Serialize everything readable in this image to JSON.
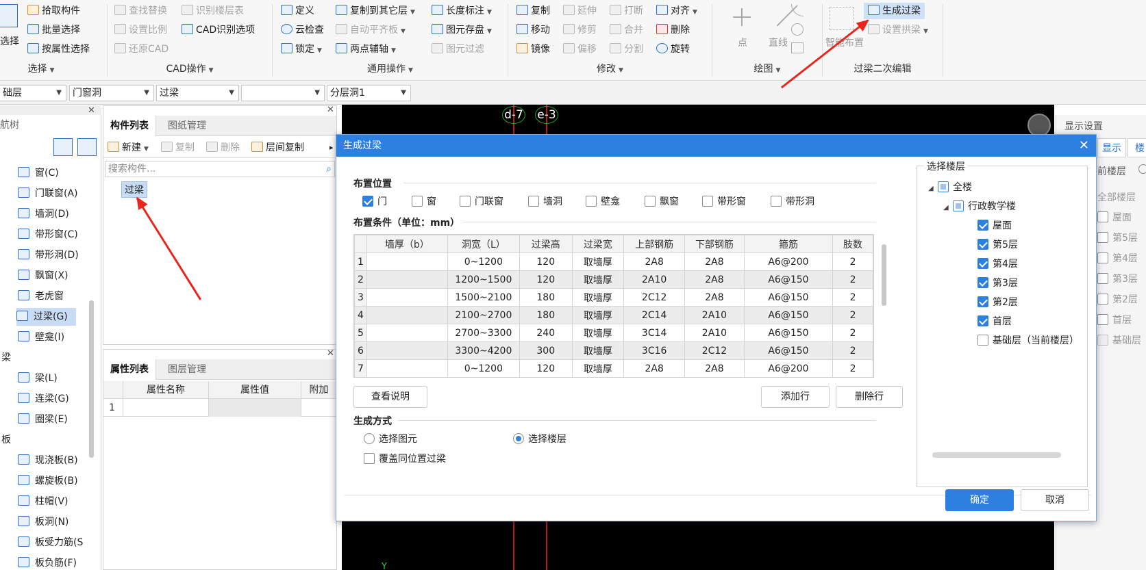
{
  "ribbon": {
    "select_group": {
      "big_button": "选择",
      "buttons": [
        "拾取构件",
        "批量选择",
        "按属性选择"
      ],
      "label": "选择"
    },
    "cad_group": {
      "buttons": [
        "查找替换",
        "识别楼层表",
        "设置比例",
        "CAD识别选项",
        "还原CAD"
      ],
      "label": "CAD操作"
    },
    "common_group": {
      "buttons": [
        "定义",
        "复制到其它层",
        "长度标注",
        "云检查",
        "自动平齐板",
        "图元存盘",
        "锁定",
        "两点辅轴",
        "图元过滤"
      ],
      "label": "通用操作"
    },
    "modify_group": {
      "buttons": [
        "复制",
        "延伸",
        "打断",
        "对齐",
        "移动",
        "修剪",
        "合并",
        "删除",
        "镜像",
        "偏移",
        "分割",
        "旋转"
      ],
      "label": "修改"
    },
    "draw_group": {
      "buttons": [
        "点",
        "直线"
      ],
      "label": "绘图"
    },
    "lintel_group": {
      "smart_layout": "智能布置",
      "generate": "生成过梁",
      "set_splice": "设置拱梁",
      "label": "过梁二次编辑"
    }
  },
  "dropdowns": [
    "础层",
    "门窗洞",
    "过梁",
    "",
    "分层洞1"
  ],
  "nav": {
    "title": "航树",
    "items": [
      {
        "label": "窗(C)",
        "icon": "window-icon"
      },
      {
        "label": "门联窗(A)",
        "icon": "door-window-icon"
      },
      {
        "label": "墙洞(D)",
        "icon": "wall-opening-icon"
      },
      {
        "label": "带形窗(C)",
        "icon": "strip-window-icon"
      },
      {
        "label": "带形洞(D)",
        "icon": "strip-opening-icon"
      },
      {
        "label": "飘窗(X)",
        "icon": "bay-window-icon"
      },
      {
        "label": "老虎窗",
        "icon": "dormer-icon"
      },
      {
        "label": "过梁(G)",
        "icon": "lintel-icon"
      },
      {
        "label": "壁龛(I)",
        "icon": "niche-icon"
      }
    ],
    "cat_beam": "梁",
    "beam_items": [
      {
        "label": "梁(L)",
        "icon": "beam-icon"
      },
      {
        "label": "连梁(G)",
        "icon": "coupling-beam-icon"
      },
      {
        "label": "圈梁(E)",
        "icon": "ring-beam-icon"
      }
    ],
    "cat_slab": "板",
    "slab_items": [
      {
        "label": "现浇板(B)",
        "icon": "cast-slab-icon"
      },
      {
        "label": "螺旋板(B)",
        "icon": "spiral-slab-icon"
      },
      {
        "label": "柱帽(V)",
        "icon": "column-cap-icon"
      },
      {
        "label": "板洞(N)",
        "icon": "slab-hole-icon"
      },
      {
        "label": "板受力筋(S",
        "icon": "slab-rebar-icon"
      },
      {
        "label": "板负筋(F)",
        "icon": "slab-neg-rebar-icon"
      }
    ]
  },
  "component_panel": {
    "tabs": [
      "构件列表",
      "图纸管理"
    ],
    "toolbar": [
      "新建",
      "复制",
      "删除",
      "层间复制"
    ],
    "search_placeholder": "搜索构件...",
    "item": "过梁"
  },
  "property_panel": {
    "tabs": [
      "属性列表",
      "图层管理"
    ],
    "columns": [
      "属性名称",
      "属性值",
      "附加"
    ],
    "row_num": "1"
  },
  "canvas": {
    "axis_labels": [
      "d-7",
      "e-3"
    ],
    "y_label": "Y"
  },
  "right_panel": {
    "title": "显示设置",
    "tabs": [
      "显示",
      "楼"
    ],
    "current": "前楼层",
    "all": "全部楼层",
    "floors": [
      "屋面",
      "第5层",
      "第4层",
      "第3层",
      "第2层",
      "首层",
      "基础层"
    ]
  },
  "dialog": {
    "title": "生成过梁",
    "position_label": "布置位置",
    "positions": [
      {
        "label": "门",
        "checked": true
      },
      {
        "label": "窗",
        "checked": false
      },
      {
        "label": "门联窗",
        "checked": false
      },
      {
        "label": "墙洞",
        "checked": false
      },
      {
        "label": "壁龛",
        "checked": false
      },
      {
        "label": "飘窗",
        "checked": false
      },
      {
        "label": "带形窗",
        "checked": false
      },
      {
        "label": "带形洞",
        "checked": false
      }
    ],
    "condition_label": "布置条件（单位：mm）",
    "columns": [
      "墙厚（b）",
      "洞宽（L）",
      "过梁高",
      "过梁宽",
      "上部钢筋",
      "下部钢筋",
      "箍筋",
      "肢数"
    ],
    "rows": [
      [
        "1",
        "",
        "0~1200",
        "120",
        "取墙厚",
        "2A8",
        "2A8",
        "A6@200",
        "2"
      ],
      [
        "2",
        "",
        "1200~1500",
        "120",
        "取墙厚",
        "2A10",
        "2A8",
        "A6@150",
        "2"
      ],
      [
        "3",
        "",
        "1500~2100",
        "180",
        "取墙厚",
        "2C12",
        "2A8",
        "A6@150",
        "2"
      ],
      [
        "4",
        "",
        "2100~2700",
        "180",
        "取墙厚",
        "2C14",
        "2A10",
        "A6@150",
        "2"
      ],
      [
        "5",
        "",
        "2700~3300",
        "240",
        "取墙厚",
        "3C14",
        "2A10",
        "A6@150",
        "2"
      ],
      [
        "6",
        "",
        "3300~4200",
        "300",
        "取墙厚",
        "3C16",
        "2C12",
        "A6@150",
        "2"
      ],
      [
        "7",
        "",
        "0~1200",
        "120",
        "取墙厚",
        "2A8",
        "2A8",
        "A6@200",
        "2"
      ]
    ],
    "view_desc": "查看说明",
    "add_row": "添加行",
    "delete_row": "删除行",
    "method_label": "生成方式",
    "method_element": "选择图元",
    "method_floor": "选择楼层",
    "overwrite": "覆盖同位置过梁",
    "floor_panel_title": "选择楼层",
    "floor_tree": {
      "all": "全楼",
      "building": "行政教学楼",
      "floors": [
        {
          "label": "屋面",
          "checked": true
        },
        {
          "label": "第5层",
          "checked": true
        },
        {
          "label": "第4层",
          "checked": true
        },
        {
          "label": "第3层",
          "checked": true
        },
        {
          "label": "第2层",
          "checked": true
        },
        {
          "label": "首层",
          "checked": true
        },
        {
          "label": "基础层（当前楼层）",
          "checked": false
        }
      ]
    },
    "ok": "确定",
    "cancel": "取消"
  }
}
